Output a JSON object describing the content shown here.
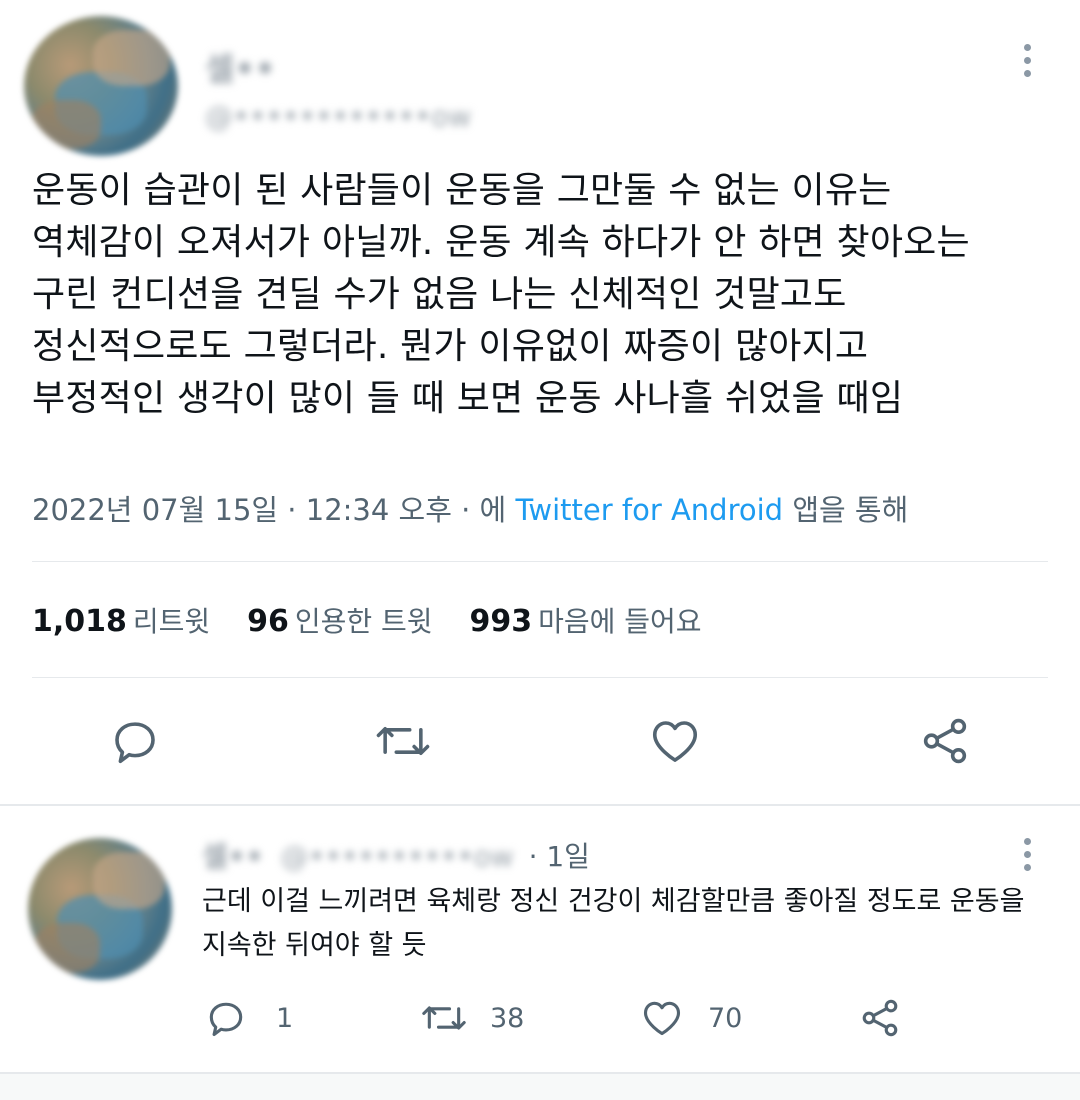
{
  "tweet": {
    "author_name": "셀••",
    "author_handle": "@••••••••••••ow",
    "text_lines": [
      "운동이 습관이 된 사람들이 운동을 그만둘 수 없는 이유는",
      "역체감이 오져서가 아닐까. 운동 계속 하다가 안 하면 찾아오는",
      "구린 컨디션을 견딜 수가 없음 나는 신체적인 것말고도",
      "정신적으로도 그렇더라. 뭔가 이유없이 짜증이 많아지고",
      "부정적인 생각이 많이 들 때 보면 운동 사나흘 쉬었을 때임"
    ],
    "timestamp": "2022년 07월 15일 · 12:34 오후 · 에",
    "source": "Twitter for Android",
    "source_suffix": "앱을 통해",
    "stats": {
      "retweets_count": "1,018",
      "retweets_label": "리트윗",
      "quotes_count": "96",
      "quotes_label": "인용한 트윗",
      "likes_count": "993",
      "likes_label": "마음에 들어요"
    }
  },
  "reply": {
    "author_name": "셀••",
    "author_handle": "@••••••••••ow",
    "time": "· 1일",
    "text_lines": [
      "근데 이걸 느끼려면 육체랑 정신 건강이 체감할만큼 좋아질 정도로 운동을",
      "지속한 뒤여야 할 듯"
    ],
    "reply_count": "1",
    "retweet_count": "38",
    "like_count": "70"
  },
  "colors": {
    "text": "#0f1419",
    "secondary": "#536471",
    "link": "#1d9bf0",
    "divider": "#e6e9ec"
  },
  "icons": [
    "more-icon",
    "reply-icon",
    "retweet-icon",
    "like-icon",
    "share-icon"
  ]
}
